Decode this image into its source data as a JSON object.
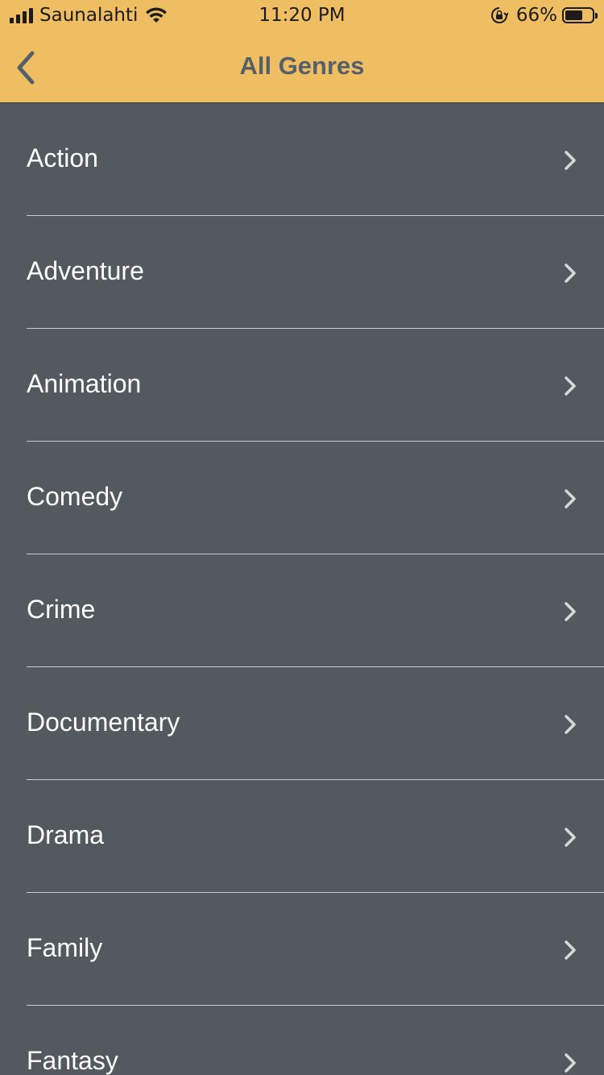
{
  "status_bar": {
    "carrier": "Saunalahti",
    "time": "11:20 PM",
    "battery_percent": "66%",
    "battery_level": 0.66,
    "signal_bars": 4,
    "icons": [
      "signal-icon",
      "wifi-icon",
      "orientation-lock-icon",
      "battery-icon"
    ]
  },
  "nav": {
    "title": "All Genres",
    "back_icon": "chevron-left-icon"
  },
  "genres": [
    {
      "label": "Action"
    },
    {
      "label": "Adventure"
    },
    {
      "label": "Animation"
    },
    {
      "label": "Comedy"
    },
    {
      "label": "Crime"
    },
    {
      "label": "Documentary"
    },
    {
      "label": "Drama"
    },
    {
      "label": "Family"
    },
    {
      "label": "Fantasy"
    }
  ],
  "colors": {
    "header_background": "#f0be62",
    "list_background": "#525a60",
    "title_text": "#56606a",
    "row_text": "#ffffff",
    "separator": "#c9ccce",
    "chevron": "#d6d8da"
  }
}
